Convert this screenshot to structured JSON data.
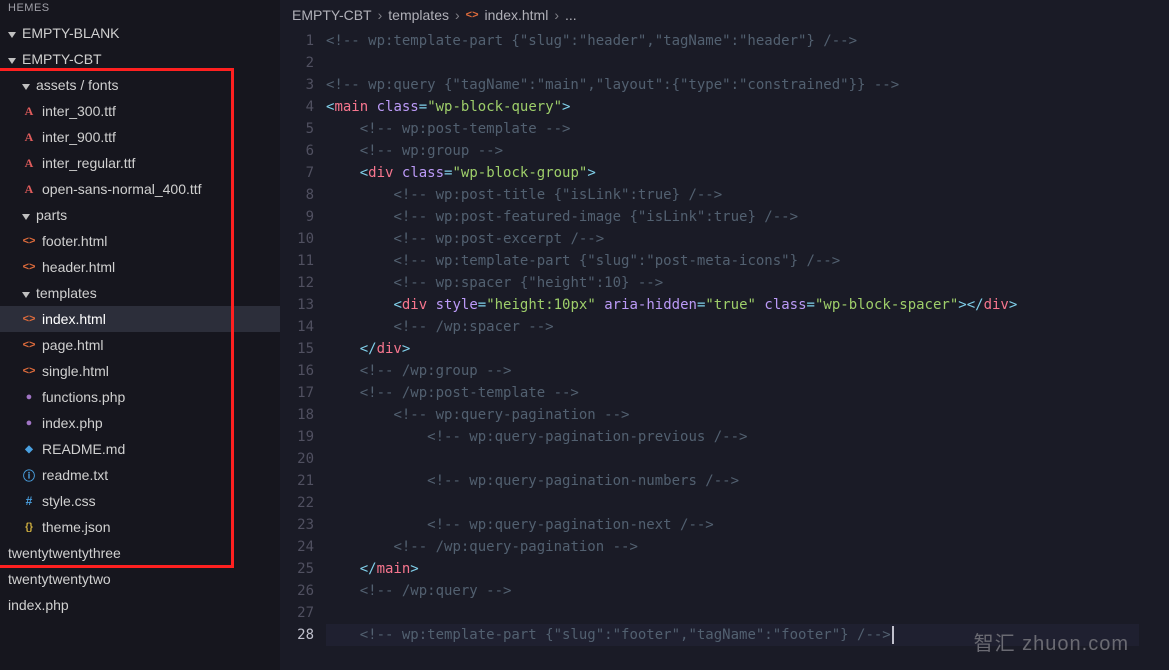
{
  "sidebar": {
    "heading": "HEMES",
    "root1": "EMPTY-BLANK",
    "root2": "EMPTY-CBT",
    "folder_assets": "assets / fonts",
    "f_inter300": "inter_300.ttf",
    "f_inter900": "inter_900.ttf",
    "f_interreg": "inter_regular.ttf",
    "f_opensans": "open-sans-normal_400.ttf",
    "folder_parts": "parts",
    "p_footer": "footer.html",
    "p_header": "header.html",
    "folder_templates": "templates",
    "t_index": "index.html",
    "t_page": "page.html",
    "t_single": "single.html",
    "f_functions": "functions.php",
    "f_indexphp": "index.php",
    "f_readmemd": "README.md",
    "f_readmetxt": "readme.txt",
    "f_stylecss": "style.css",
    "f_themejson": "theme.json",
    "root3": "twentytwentythree",
    "root4": "twentytwentytwo",
    "root5": "index.php"
  },
  "breadcrumbs": {
    "a": "EMPTY-CBT",
    "b": "templates",
    "c": "index.html",
    "d": "..."
  },
  "code": {
    "lines": [
      {
        "n": 1,
        "indent": 0,
        "raw": "<!-- wp:template-part {\"slug\":\"header\",\"tagName\":\"header\"} /-->"
      },
      {
        "n": 2,
        "indent": 0,
        "raw": ""
      },
      {
        "n": 3,
        "indent": 0,
        "raw": "<!-- wp:query {\"tagName\":\"main\",\"layout\":{\"type\":\"constrained\"}} -->"
      },
      {
        "n": 4,
        "indent": 0,
        "raw": "<main class=\"wp-block-query\">"
      },
      {
        "n": 5,
        "indent": 1,
        "raw": "<!-- wp:post-template -->"
      },
      {
        "n": 6,
        "indent": 1,
        "raw": "<!-- wp:group -->"
      },
      {
        "n": 7,
        "indent": 1,
        "raw": "<div class=\"wp-block-group\">"
      },
      {
        "n": 8,
        "indent": 2,
        "raw": "<!-- wp:post-title {\"isLink\":true} /-->"
      },
      {
        "n": 9,
        "indent": 2,
        "raw": "<!-- wp:post-featured-image {\"isLink\":true} /-->"
      },
      {
        "n": 10,
        "indent": 2,
        "raw": "<!-- wp:post-excerpt /-->"
      },
      {
        "n": 11,
        "indent": 2,
        "raw": "<!-- wp:template-part {\"slug\":\"post-meta-icons\"} /-->"
      },
      {
        "n": 12,
        "indent": 2,
        "raw": "<!-- wp:spacer {\"height\":10} -->"
      },
      {
        "n": 13,
        "indent": 2,
        "raw": "<div style=\"height:10px\" aria-hidden=\"true\" class=\"wp-block-spacer\"></div>"
      },
      {
        "n": 14,
        "indent": 2,
        "raw": "<!-- /wp:spacer -->"
      },
      {
        "n": 15,
        "indent": 1,
        "raw": "</div>"
      },
      {
        "n": 16,
        "indent": 1,
        "raw": "<!-- /wp:group -->"
      },
      {
        "n": 17,
        "indent": 1,
        "raw": "<!-- /wp:post-template -->"
      },
      {
        "n": 18,
        "indent": 2,
        "raw": "<!-- wp:query-pagination -->"
      },
      {
        "n": 19,
        "indent": 3,
        "raw": "<!-- wp:query-pagination-previous /-->"
      },
      {
        "n": 20,
        "indent": 3,
        "raw": ""
      },
      {
        "n": 21,
        "indent": 3,
        "raw": "<!-- wp:query-pagination-numbers /-->"
      },
      {
        "n": 22,
        "indent": 3,
        "raw": ""
      },
      {
        "n": 23,
        "indent": 3,
        "raw": "<!-- wp:query-pagination-next /-->"
      },
      {
        "n": 24,
        "indent": 2,
        "raw": "<!-- /wp:query-pagination -->"
      },
      {
        "n": 25,
        "indent": 1,
        "raw": "</main>"
      },
      {
        "n": 26,
        "indent": 1,
        "raw": "<!-- /wp:query -->"
      },
      {
        "n": 27,
        "indent": 1,
        "raw": ""
      },
      {
        "n": 28,
        "indent": 1,
        "raw": "<!-- wp:template-part {\"slug\":\"footer\",\"tagName\":\"footer\"} /-->"
      }
    ]
  },
  "watermark": "智汇 zhuon.com"
}
